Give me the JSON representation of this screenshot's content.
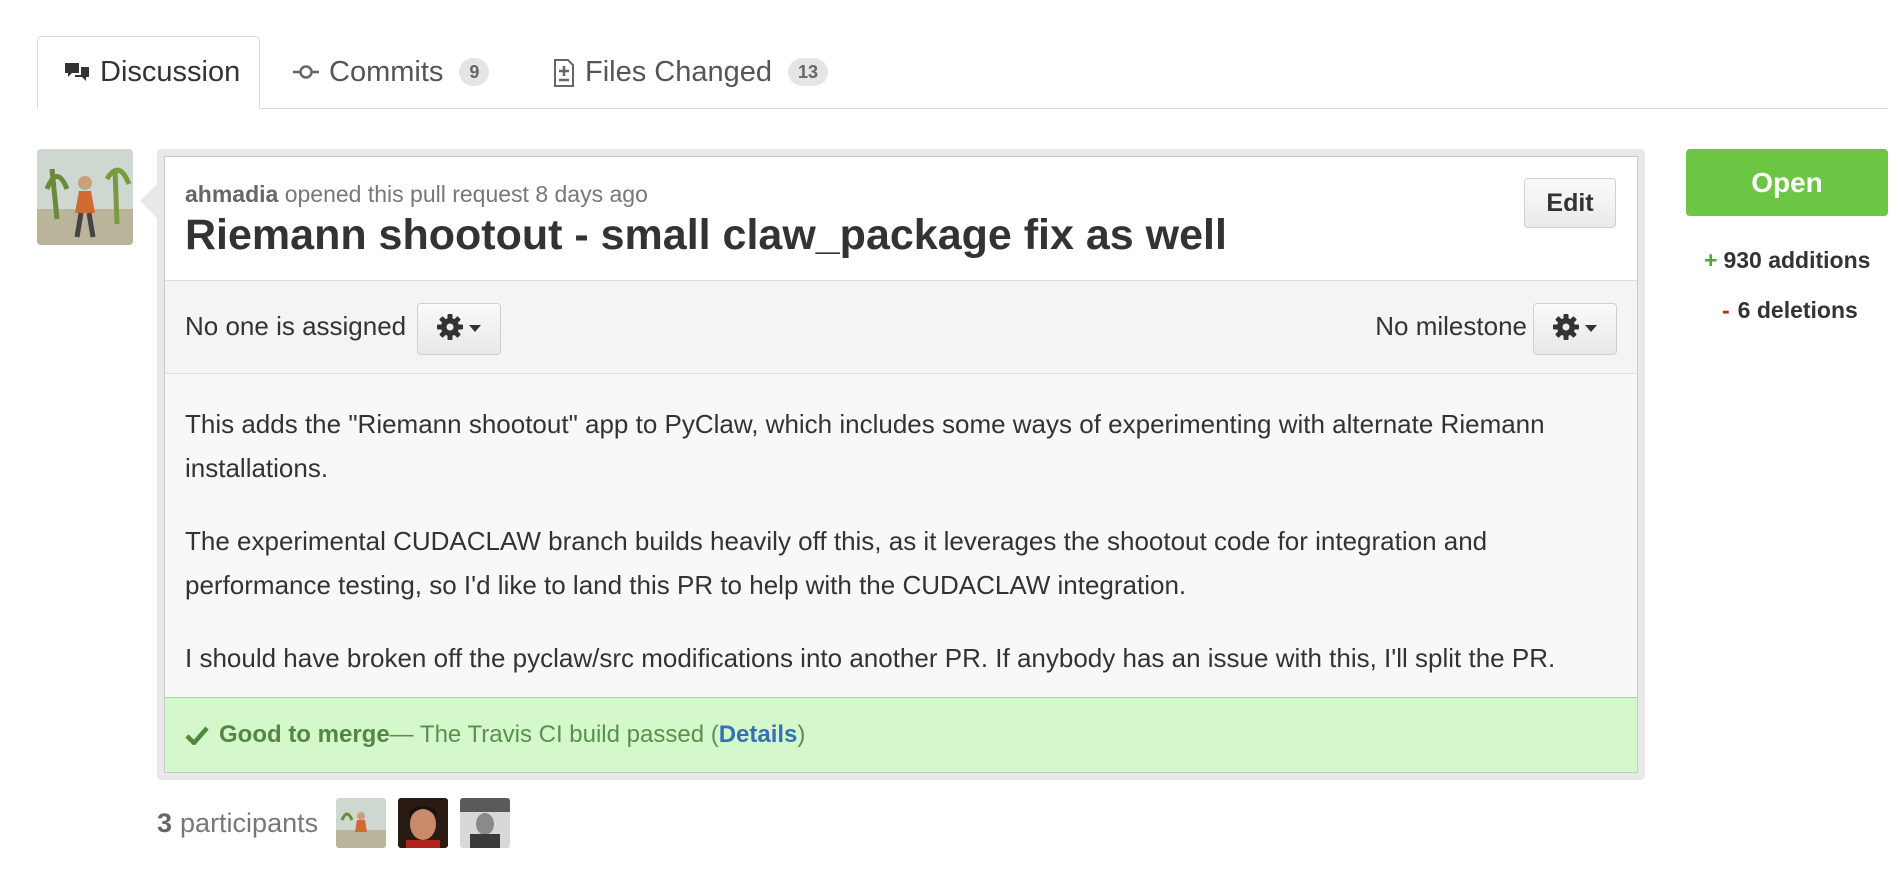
{
  "tabs": {
    "discussion": {
      "label": "Discussion"
    },
    "commits": {
      "label": "Commits",
      "count": "9"
    },
    "files": {
      "label": "Files Changed",
      "count": "13"
    }
  },
  "pull_request": {
    "author": "ahmadia",
    "opened_text": " opened this pull request 8 days ago",
    "title": "Riemann shootout - small claw_package fix as well",
    "edit_label": "Edit",
    "assignee_text": "No one is assigned",
    "milestone_text": "No milestone",
    "body": [
      "This adds the \"Riemann shootout\" app to PyClaw, which includes some ways of experimenting with alternate Riemann installations.",
      "The experimental CUDACLAW branch builds heavily off this, as it leverages the shootout code for integration and performance testing, so I'd like to land this PR to help with the CUDACLAW integration.",
      "I should have broken off the pyclaw/src modifications into another PR. If anybody has an issue with this, I'll split the PR."
    ],
    "merge": {
      "status": "Good to merge",
      "message": " — The Travis CI build passed (",
      "details_label": "Details",
      "close_paren": ")"
    }
  },
  "participants": {
    "count": "3",
    "label": "participants"
  },
  "sidebar": {
    "state": "Open",
    "additions_sign": "+",
    "additions": "930 additions",
    "deletions_sign": "-",
    "deletions": "6 deletions"
  },
  "colors": {
    "open_green": "#6cc644",
    "merge_bg": "#d4f7cc",
    "link_blue": "#3572b0"
  },
  "icons": {
    "discussion": "speech-bubbles-icon",
    "commits": "commit-icon",
    "files": "diff-file-icon",
    "gear": "gear-icon",
    "caret": "caret-down-icon",
    "check": "check-icon"
  }
}
